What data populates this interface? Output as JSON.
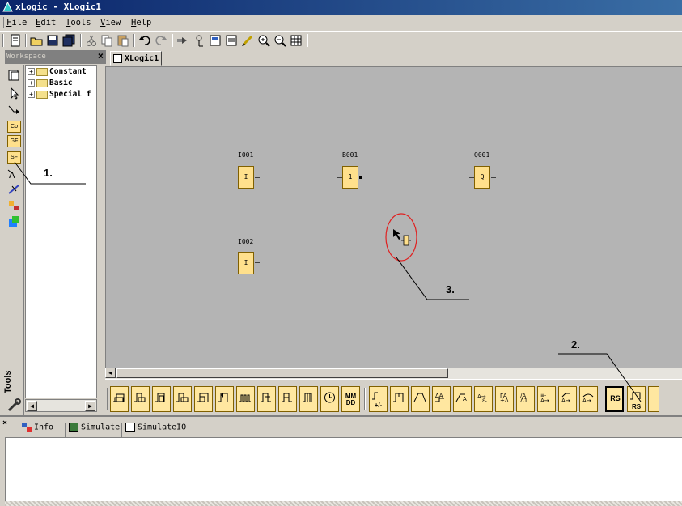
{
  "window": {
    "title": "xLogic - XLogic1"
  },
  "menu": [
    "File",
    "Edit",
    "Tools",
    "View",
    "Help"
  ],
  "menu_accel": [
    "F",
    "E",
    "T",
    "V",
    "H"
  ],
  "toolbar": {
    "icons": [
      "new-icon",
      "open-icon",
      "save-icon",
      "save-all-icon",
      "cut-icon",
      "copy-icon",
      "paste-icon",
      "undo-icon",
      "redo-icon",
      "select-tool-icon",
      "connect-tool-icon",
      "insert-text-icon",
      "simulate-icon",
      "pen-icon",
      "zoom-in-icon",
      "zoom-out-icon",
      "grid-icon"
    ]
  },
  "workspace": {
    "title": "Workspace",
    "close": "×",
    "tree": [
      "Constant",
      "Basic",
      "Special f"
    ],
    "side_tools": [
      "Co",
      "GF",
      "SF"
    ],
    "tools_label": "Tools"
  },
  "document": {
    "tab": "XLogic1"
  },
  "blocks": [
    {
      "label": "I001",
      "symbol": "I"
    },
    {
      "label": "B001",
      "symbol": "1"
    },
    {
      "label": "Q001",
      "symbol": "Q"
    },
    {
      "label": "I002",
      "symbol": "I"
    }
  ],
  "func_toolbar": {
    "text_items": [
      "MM DD",
      "+/-",
      "RS",
      "RS"
    ]
  },
  "info_tabs": [
    "Info",
    "Simulate",
    "SimulateIO"
  ],
  "annotations": [
    "1.",
    "2.",
    "3."
  ],
  "colors": {
    "block_fill": "#ffe08c",
    "canvas": "#b4b4b4",
    "titlebar": "#0a246a",
    "highlight_ellipse": "#e02020"
  }
}
